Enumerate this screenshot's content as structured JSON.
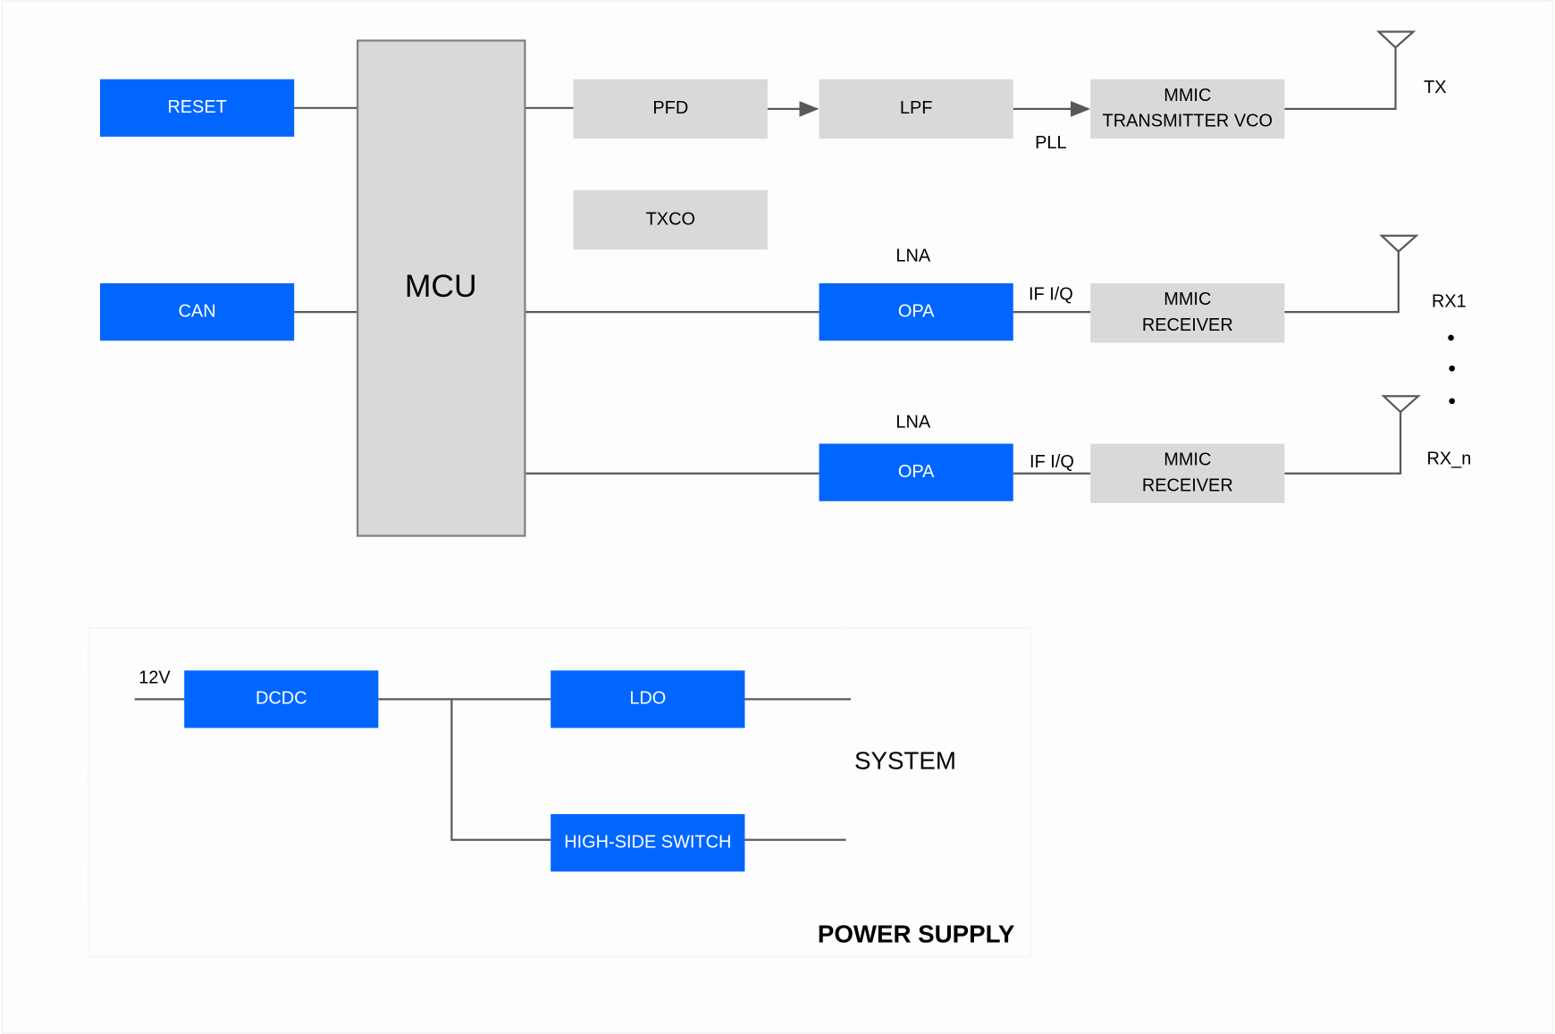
{
  "colors": {
    "accent_block": "#0066ff",
    "neutral_block": "#d9d9d9",
    "line": "#595959"
  },
  "blocks": {
    "reset": "RESET",
    "can": "CAN",
    "mcu": "MCU",
    "pfd": "PFD",
    "txco": "TXCO",
    "lpf": "LPF",
    "mmic_tx_line1": "MMIC",
    "mmic_tx_line2": "TRANSMITTER VCO",
    "opa1": "OPA",
    "opa2": "OPA",
    "mmic_rx1_line1": "MMIC",
    "mmic_rx1_line2": "RECEIVER",
    "mmic_rx2_line1": "MMIC",
    "mmic_rx2_line2": "RECEIVER",
    "dcdc": "DCDC",
    "ldo": "LDO",
    "hss": "HIGH-SIDE SWITCH"
  },
  "labels": {
    "pll": "PLL",
    "tx": "TX",
    "rx1": "RX1",
    "rxn": "RX_n",
    "lna1": "LNA",
    "lna2": "LNA",
    "ifiq1": "IF I/Q",
    "ifiq2": "IF I/Q",
    "v12": "12V",
    "system": "SYSTEM",
    "power_supply": "POWER SUPPLY"
  },
  "antenna_icon": "antenna-icon"
}
